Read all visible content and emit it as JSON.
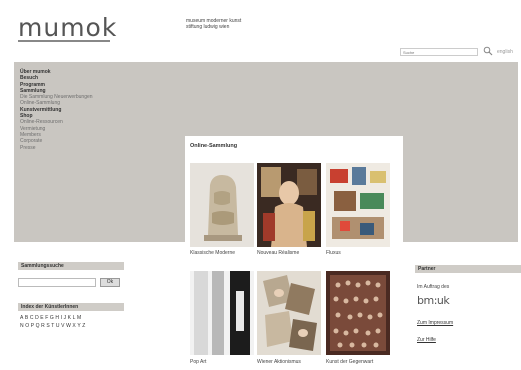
{
  "header": {
    "logo": "mumok",
    "tagline_line1": "museum moderner kunst",
    "tagline_line2": "stiftung ludwig wien"
  },
  "search": {
    "placeholder": "Suche",
    "language": "english"
  },
  "menu": [
    {
      "label": "Über mumok",
      "style": "bold"
    },
    {
      "label": "Besuch",
      "style": "bold"
    },
    {
      "label": "Programm",
      "style": "bold"
    },
    {
      "label": "Sammlung",
      "style": "bold"
    },
    {
      "label": "Die Sammlung    Neuerwerbungen",
      "style": "gray"
    },
    {
      "label": "Online-Sammlung",
      "style": "gray"
    },
    {
      "label": "",
      "style": "gray"
    },
    {
      "label": "Kunstvermittlung",
      "style": "bold"
    },
    {
      "label": "Shop",
      "style": "bold"
    },
    {
      "label": "Online-Ressourcen",
      "style": "gray"
    },
    {
      "label": "Vermietung",
      "style": "gray"
    },
    {
      "label": "Members",
      "style": "gray"
    },
    {
      "label": "Corporate",
      "style": "gray"
    },
    {
      "label": "Presse",
      "style": "gray"
    }
  ],
  "online_collection": {
    "title": "Online-Sammlung",
    "items": [
      {
        "caption": "Klassische Moderne"
      },
      {
        "caption": "Nouveau Réalisme"
      },
      {
        "caption": "Fluxus"
      },
      {
        "caption": "Pop Art"
      },
      {
        "caption": "Wiener Aktionismus"
      },
      {
        "caption": "Kunst der Gegenwart"
      }
    ]
  },
  "collection_search": {
    "title": "Sammlungssuche",
    "ok_label": "Ok"
  },
  "artist_index": {
    "title": "Index der KünstlerInnen",
    "row1": "ABCDEFGHIJKLM",
    "row2": "NOPQRSTUVWXYZ"
  },
  "partner": {
    "title": "Partner",
    "commission": "Im Auftrag des",
    "logo_text": "bm:uk",
    "imprint_link": "Zum Impressum",
    "help_link": "Zur Hilfe"
  },
  "colors": {
    "band": "#c9c6c1",
    "box_title": "#cfccc7"
  }
}
